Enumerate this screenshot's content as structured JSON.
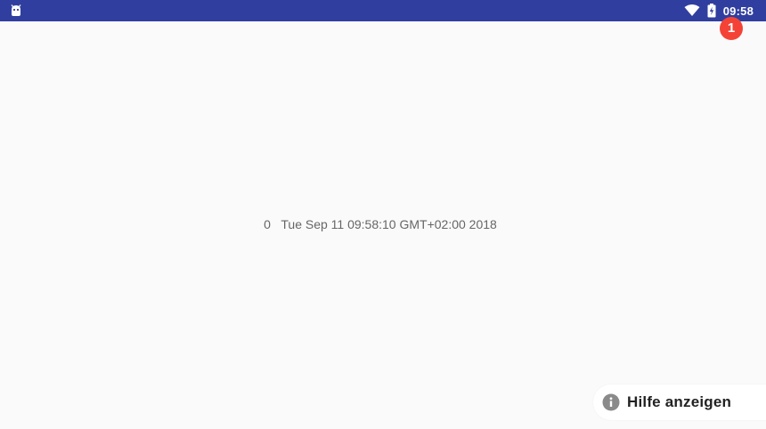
{
  "status_bar": {
    "time": "09:58",
    "background": "#303f9f",
    "left_icon": "android-robot-icon",
    "icons": [
      "wifi-icon",
      "battery-charging-icon"
    ]
  },
  "notification_badge": {
    "count": "1",
    "color": "#f44336"
  },
  "main": {
    "counter": "0",
    "timestamp": "Tue Sep 11 09:58:10 GMT+02:00 2018"
  },
  "help_button": {
    "label": "Hilfe anzeigen",
    "icon": "info-icon"
  }
}
